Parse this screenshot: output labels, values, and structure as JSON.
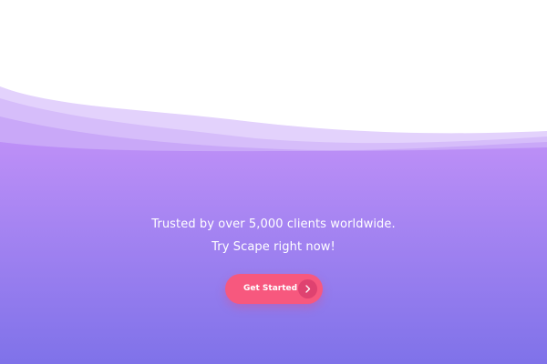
{
  "hero": {
    "line1": "Trusted by over 5,000 clients worldwide.",
    "line2": "Try Scape right now!",
    "cta_label": "Get Started",
    "cta_icon": "chevron-right-icon"
  },
  "colors": {
    "background": "#ffffff",
    "gradient_top": "#bd8ff7",
    "gradient_bottom": "#7f72e9",
    "wave_light": "#dcc6fb",
    "cta_background": "#f7587e",
    "cta_icon_background": "#df4270",
    "text": "#ffffff"
  }
}
